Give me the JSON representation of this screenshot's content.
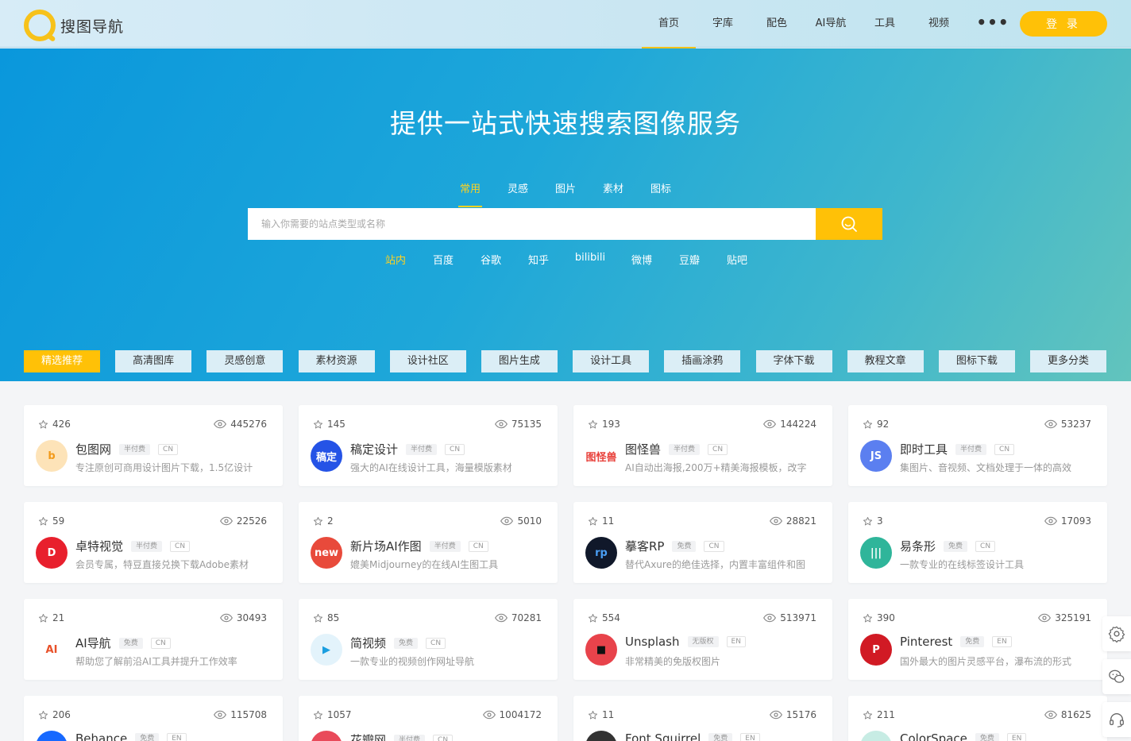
{
  "header": {
    "logo_text": "搜图导航",
    "nav": [
      "首页",
      "字库",
      "配色",
      "AI导航",
      "工具",
      "视频"
    ],
    "login": "登 录"
  },
  "hero": {
    "title": "提供一站式快速搜索图像服务",
    "tabs": [
      "常用",
      "灵感",
      "图片",
      "素材",
      "图标"
    ],
    "search_placeholder": "输入你需要的站点类型或名称",
    "engines": [
      "站内",
      "百度",
      "谷歌",
      "知乎",
      "bilibili",
      "微博",
      "豆瓣",
      "贴吧"
    ]
  },
  "categories": [
    "精选推荐",
    "高清图库",
    "灵感创意",
    "素材资源",
    "设计社区",
    "图片生成",
    "设计工具",
    "插画涂鸦",
    "字体下载",
    "教程文章",
    "图标下载",
    "更多分类"
  ],
  "colors": {
    "accent": "#ffc107",
    "hero_start": "#0a97dc",
    "hero_end": "#62c4bd"
  },
  "cards": [
    {
      "stars": "426",
      "views": "445276",
      "name": "包图网",
      "tag": "半付费",
      "lang": "CN",
      "desc": "专注原创可商用设计图片下载，1.5亿设计",
      "logo": "b",
      "logo_bg": "#fde3b8",
      "logo_fg": "#f29a1a"
    },
    {
      "stars": "145",
      "views": "75135",
      "name": "稿定设计",
      "tag": "半付费",
      "lang": "CN",
      "desc": "强大的AI在线设计工具，海量模版素材",
      "logo": "稿定",
      "logo_bg": "#2553e6",
      "logo_fg": "#ffffff"
    },
    {
      "stars": "193",
      "views": "144224",
      "name": "图怪兽",
      "tag": "半付费",
      "lang": "CN",
      "desc": "AI自动出海报,200万+精美海报模板，改字",
      "logo": "图怪兽",
      "logo_bg": "#ffffff",
      "logo_fg": "#e8403a"
    },
    {
      "stars": "92",
      "views": "53237",
      "name": "即时工具",
      "tag": "半付费",
      "lang": "CN",
      "desc": "集图片、音视频、文档处理于一体的高效",
      "logo": "JS",
      "logo_bg": "#5b7ff0",
      "logo_fg": "#ffffff"
    },
    {
      "stars": "59",
      "views": "22526",
      "name": "卓特视觉",
      "tag": "半付费",
      "lang": "CN",
      "desc": "会员专属，特豆直接兑换下载Adobe素材",
      "logo": "D",
      "logo_bg": "#e8202d",
      "logo_fg": "#ffffff"
    },
    {
      "stars": "2",
      "views": "5010",
      "name": "新片场AI作图",
      "tag": "半付费",
      "lang": "CN",
      "desc": "媲美Midjourney的在线AI生图工具",
      "logo": "new",
      "logo_bg": "#e84a3b",
      "logo_fg": "#ffffff"
    },
    {
      "stars": "11",
      "views": "28821",
      "name": "摹客RP",
      "tag": "免费",
      "lang": "CN",
      "desc": "替代Axure的绝佳选择，内置丰富组件和图",
      "logo": "rp",
      "logo_bg": "#10182a",
      "logo_fg": "#4a9ff5"
    },
    {
      "stars": "3",
      "views": "17093",
      "name": "易条形",
      "tag": "免费",
      "lang": "CN",
      "desc": "一款专业的在线标签设计工具",
      "logo": "|||",
      "logo_bg": "#2fb59a",
      "logo_fg": "#ffffff"
    },
    {
      "stars": "21",
      "views": "30493",
      "name": "AI导航",
      "tag": "免费",
      "lang": "CN",
      "desc": "帮助您了解前沿AI工具并提升工作效率",
      "logo": "AI",
      "logo_bg": "#ffffff",
      "logo_fg": "#e8512a"
    },
    {
      "stars": "85",
      "views": "70281",
      "name": "简视频",
      "tag": "免费",
      "lang": "CN",
      "desc": "一款专业的视频创作网址导航",
      "logo": "▶",
      "logo_bg": "#e3f3fb",
      "logo_fg": "#1a9ee0"
    },
    {
      "stars": "554",
      "views": "513971",
      "name": "Unsplash",
      "tag": "无版权",
      "lang": "EN",
      "desc": "非常精美的免版权图片",
      "logo": "■",
      "logo_bg": "#e8434b",
      "logo_fg": "#111111"
    },
    {
      "stars": "390",
      "views": "325191",
      "name": "Pinterest",
      "tag": "免费",
      "lang": "EN",
      "desc": "国外最大的图片灵感平台，瀑布流的形式",
      "logo": "P",
      "logo_bg": "#d11a24",
      "logo_fg": "#ffffff"
    },
    {
      "stars": "206",
      "views": "115708",
      "name": "Behance",
      "tag": "免费",
      "lang": "EN",
      "desc": "",
      "logo": "Bē",
      "logo_bg": "#1769ff",
      "logo_fg": "#ffffff"
    },
    {
      "stars": "1057",
      "views": "1004172",
      "name": "花瓣网",
      "tag": "半付费",
      "lang": "CN",
      "desc": "",
      "logo": "花",
      "logo_bg": "#e94a5a",
      "logo_fg": "#ffffff"
    },
    {
      "stars": "11",
      "views": "15176",
      "name": "Font Squirrel",
      "tag": "免费",
      "lang": "EN",
      "desc": "",
      "logo": "F",
      "logo_bg": "#333333",
      "logo_fg": "#ffffff"
    },
    {
      "stars": "211",
      "views": "81625",
      "name": "ColorSpace",
      "tag": "免费",
      "lang": "EN",
      "desc": "",
      "logo": "C",
      "logo_bg": "#c7ece4",
      "logo_fg": "#2c9b8a"
    }
  ]
}
